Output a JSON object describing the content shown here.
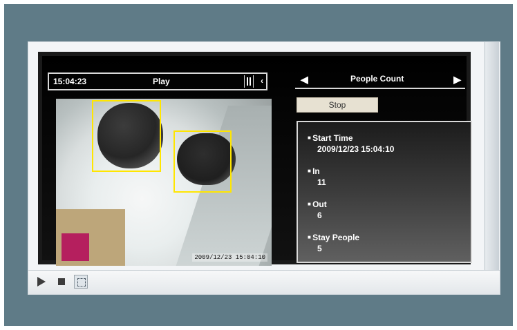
{
  "player": {
    "time": "15:04:23",
    "mode": "Play",
    "overlay_timestamp": "2009/12/23 15:04:10"
  },
  "panel": {
    "title": "People Count",
    "nav_left_icon": "left-arrow-icon",
    "nav_right_icon": "right-arrow-icon",
    "stop_label": "Stop",
    "stats": [
      {
        "label": "Start Time",
        "value": "2009/12/23 15:04:10"
      },
      {
        "label": "In",
        "value": "11"
      },
      {
        "label": "Out",
        "value": "6"
      },
      {
        "label": "Stay People",
        "value": "5"
      }
    ]
  },
  "controls": {
    "play_icon": "play-icon",
    "stop_icon": "stop-icon",
    "fullscreen_icon": "fullscreen-icon"
  }
}
